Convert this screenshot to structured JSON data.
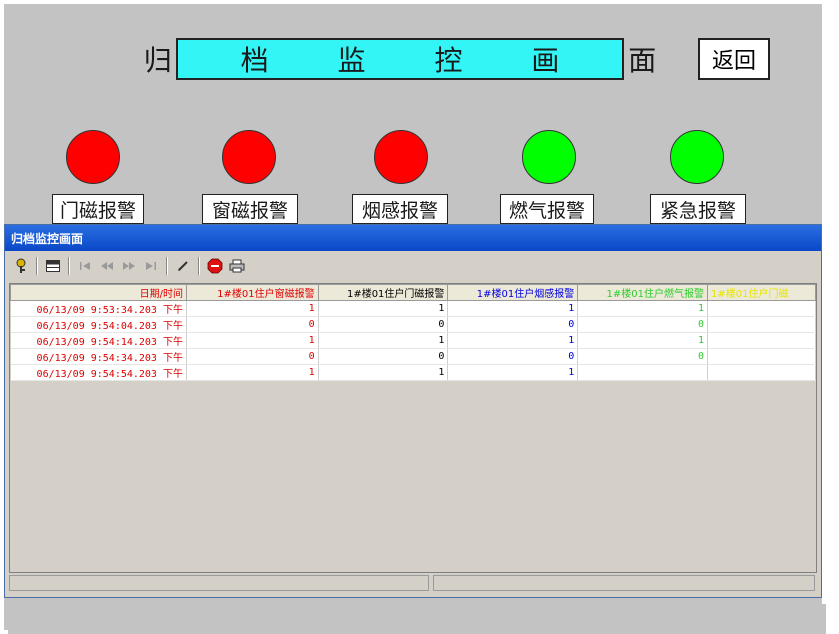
{
  "header": {
    "title": "归 档 监 控 画 面",
    "back_label": "返回"
  },
  "alarms": [
    {
      "label": "门磁报警",
      "color": "#ff0000"
    },
    {
      "label": "窗磁报警",
      "color": "#ff0000"
    },
    {
      "label": "烟感报警",
      "color": "#ff0000"
    },
    {
      "label": "燃气报警",
      "color": "#00ff00"
    },
    {
      "label": "紧急报警",
      "color": "#00ff00"
    }
  ],
  "window": {
    "title": "归档监控画面"
  },
  "toolbar": {
    "icons": [
      "key-icon",
      "grid-icon",
      "first-record-icon",
      "prev-record-icon",
      "next-record-icon",
      "last-record-icon",
      "edit-icon",
      "stop-icon",
      "print-icon"
    ]
  },
  "table": {
    "columns": [
      {
        "label": "日期/时间",
        "color": "#e00000"
      },
      {
        "label": "1#楼01住户窗磁报警",
        "color": "#e00000"
      },
      {
        "label": "1#楼01住户门磁报警",
        "color": "#000000"
      },
      {
        "label": "1#楼01住户烟感报警",
        "color": "#0000e0"
      },
      {
        "label": "1#楼01住户燃气报警",
        "color": "#2ecc2e"
      },
      {
        "label": "1#楼01住户门磁",
        "color": "#e6e600"
      }
    ],
    "rows": [
      [
        "06/13/09 9:53:34.203 下午",
        "1",
        "1",
        "1",
        "1",
        ""
      ],
      [
        "06/13/09 9:54:04.203 下午",
        "0",
        "0",
        "0",
        "0",
        ""
      ],
      [
        "06/13/09 9:54:14.203 下午",
        "1",
        "1",
        "1",
        "1",
        ""
      ],
      [
        "06/13/09 9:54:34.203 下午",
        "0",
        "0",
        "0",
        "0",
        ""
      ],
      [
        "06/13/09 9:54:54.203 下午",
        "1",
        "1",
        "1",
        "",
        ""
      ]
    ]
  }
}
